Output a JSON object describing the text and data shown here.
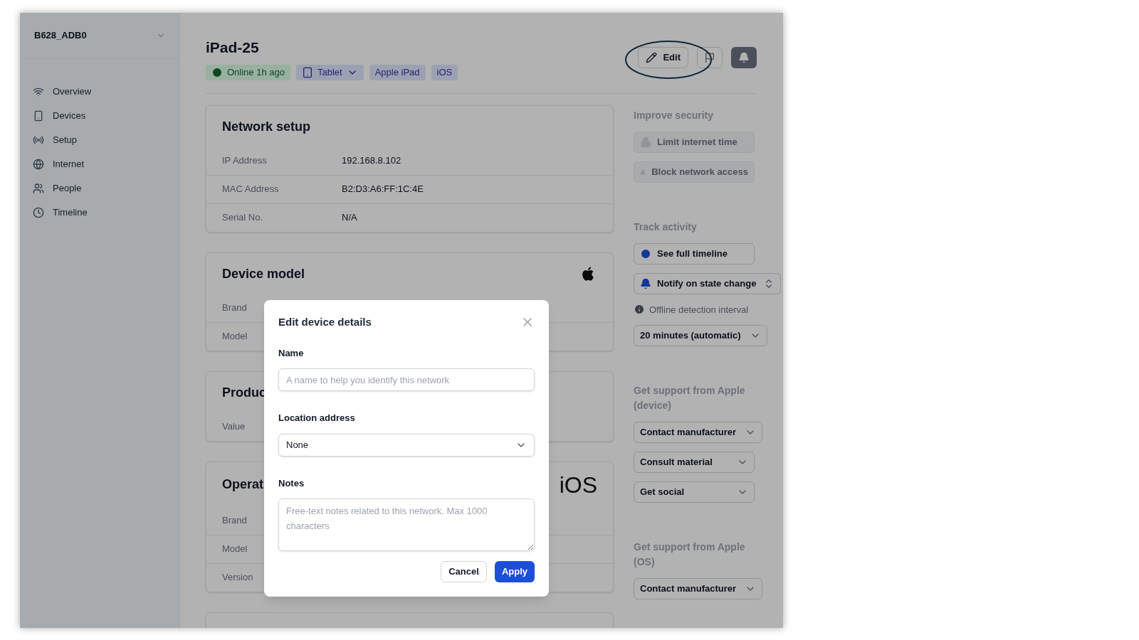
{
  "sidebar": {
    "network": "B628_ADB0",
    "items": [
      {
        "label": "Overview"
      },
      {
        "label": "Devices"
      },
      {
        "label": "Setup"
      },
      {
        "label": "Internet"
      },
      {
        "label": "People"
      },
      {
        "label": "Timeline"
      }
    ]
  },
  "header": {
    "title": "iPad-25",
    "badges": [
      {
        "kind": "status",
        "label": "Online 1h ago"
      },
      {
        "kind": "type",
        "label": "Tablet"
      },
      {
        "kind": "tag",
        "label": "Apple iPad"
      },
      {
        "kind": "tag",
        "label": "iOS"
      }
    ],
    "edit_button": "Edit"
  },
  "cards": [
    {
      "kind": "plain",
      "title": "Network setup",
      "rows": [
        {
          "label": "IP Address",
          "value": "192.168.8.102"
        },
        {
          "label": "MAC Address",
          "value": "B2:D3:A6:FF:1C:4E"
        },
        {
          "label": "Serial No.",
          "value": "N/A"
        }
      ]
    },
    {
      "kind": "icon_logo",
      "title": "Device model",
      "rows": [
        {
          "label": "Brand"
        },
        {
          "label": "Model"
        }
      ]
    },
    {
      "kind": "plain",
      "title": "Produc",
      "rows": [
        {
          "label": "Value"
        }
      ]
    },
    {
      "kind": "text_logo",
      "title": "Operat",
      "logo_text": "iOS",
      "rows": [
        {
          "label": "Brand"
        },
        {
          "label": "Model"
        },
        {
          "label": "Version"
        }
      ]
    }
  ],
  "side_sections": [
    {
      "title": "Improve security",
      "items": [
        {
          "kind": "locked",
          "label": "Limit internet time"
        },
        {
          "kind": "locked",
          "label": "Block network access"
        }
      ]
    },
    {
      "title": "Track activity",
      "items": [
        {
          "kind": "timeline",
          "label": "See full timeline"
        },
        {
          "kind": "notify",
          "label": "Notify on state change"
        },
        {
          "kind": "hint",
          "label": "Offline detection interval"
        },
        {
          "kind": "dropdown",
          "label": "20 minutes (automatic)"
        }
      ]
    },
    {
      "title": "Get support from Apple (device)",
      "items": [
        {
          "kind": "dropdown",
          "label": "Contact manufacturer"
        },
        {
          "kind": "dropdown",
          "label": "Consult material"
        },
        {
          "kind": "dropdown",
          "label": "Get social"
        }
      ]
    },
    {
      "title": "Get support from Apple (OS)",
      "items": [
        {
          "kind": "dropdown",
          "label": "Contact manufacturer"
        }
      ]
    }
  ],
  "modal": {
    "title": "Edit device details",
    "fields": [
      {
        "kind": "text",
        "label": "Name",
        "placeholder": "A name to help you identify this network"
      },
      {
        "kind": "select",
        "label": "Location address",
        "value": "None"
      },
      {
        "kind": "textarea",
        "label": "Notes",
        "placeholder": "Free-text notes related to this network. Max 1000 characters"
      }
    ],
    "buttons": [
      {
        "kind": "secondary",
        "label": "Cancel"
      },
      {
        "kind": "primary",
        "label": "Apply"
      }
    ]
  }
}
